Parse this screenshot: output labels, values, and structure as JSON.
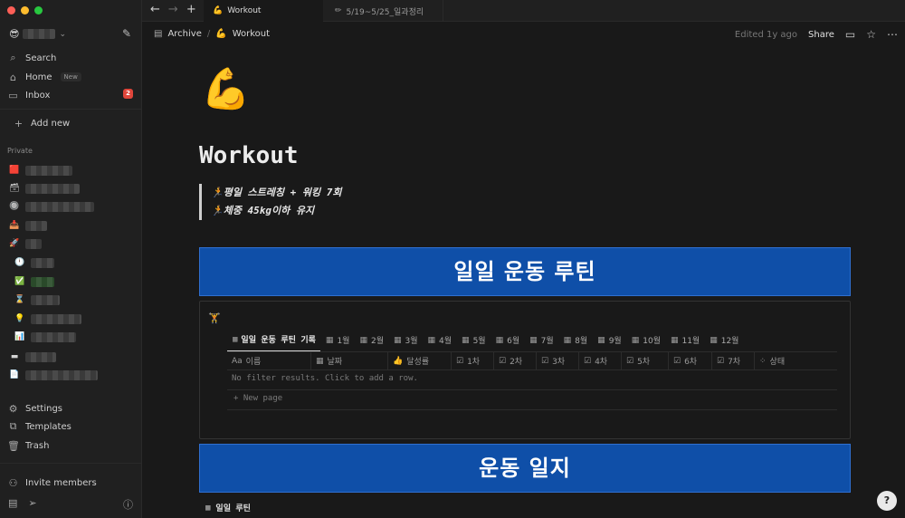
{
  "window": {
    "traffic": [
      "close",
      "minimize",
      "zoom"
    ]
  },
  "sidebar": {
    "workspace_icon": "😎",
    "nav": [
      {
        "label": "Search",
        "icon": "search-icon"
      },
      {
        "label": "Home",
        "icon": "home-icon",
        "badge": "New"
      },
      {
        "label": "Inbox",
        "icon": "inbox-icon",
        "count": "2"
      }
    ],
    "add_new": "Add new",
    "private_label": "Private",
    "pages": [
      "🟥",
      "🗃",
      "🔘",
      "📥",
      "🚀",
      "🕛",
      "✅",
      "⌛",
      "💡",
      "📊",
      "▬",
      "📄"
    ],
    "footer": [
      {
        "label": "Settings",
        "icon": "gear-icon"
      },
      {
        "label": "Templates",
        "icon": "templates-icon"
      },
      {
        "label": "Trash",
        "icon": "trash-icon"
      }
    ],
    "invite": "Invite members"
  },
  "tabs": [
    {
      "label": "Workout",
      "icon": "💪"
    },
    {
      "label": "5/19~5/25_일과정리",
      "icon": "✏"
    }
  ],
  "topbar": {
    "breadcrumb": [
      "Archive",
      "Workout"
    ],
    "edited": "Edited 1y ago",
    "share": "Share"
  },
  "page": {
    "icon": "💪",
    "title": "Workout",
    "quote": [
      "🏃평일 스트레칭 + 워킹 7회",
      "🏃체중 45kg이하 유지"
    ],
    "banner1": "일일 운동 루틴",
    "banner2": "운동 일지",
    "db_icon": "🏋"
  },
  "database": {
    "views": [
      "일일 운동 루틴 기록",
      "1월",
      "2월",
      "3월",
      "4월",
      "5월",
      "6월",
      "7월",
      "8월",
      "9월",
      "10월",
      "11월",
      "12월"
    ],
    "columns": [
      {
        "label": "이름",
        "icon": "Aa"
      },
      {
        "label": "날짜",
        "icon": "▦"
      },
      {
        "label": "달성률",
        "icon": "👍"
      },
      {
        "label": "1차",
        "icon": "☑"
      },
      {
        "label": "2차",
        "icon": "☑"
      },
      {
        "label": "3차",
        "icon": "☑"
      },
      {
        "label": "4차",
        "icon": "☑"
      },
      {
        "label": "5차",
        "icon": "☑"
      },
      {
        "label": "6차",
        "icon": "☑"
      },
      {
        "label": "7차",
        "icon": "☑"
      },
      {
        "label": "상태",
        "icon": "⁘"
      }
    ],
    "empty_text": "No filter results. Click to add a row.",
    "new_page": "+ New page"
  },
  "sub_item": "일일 루틴",
  "help": "?"
}
